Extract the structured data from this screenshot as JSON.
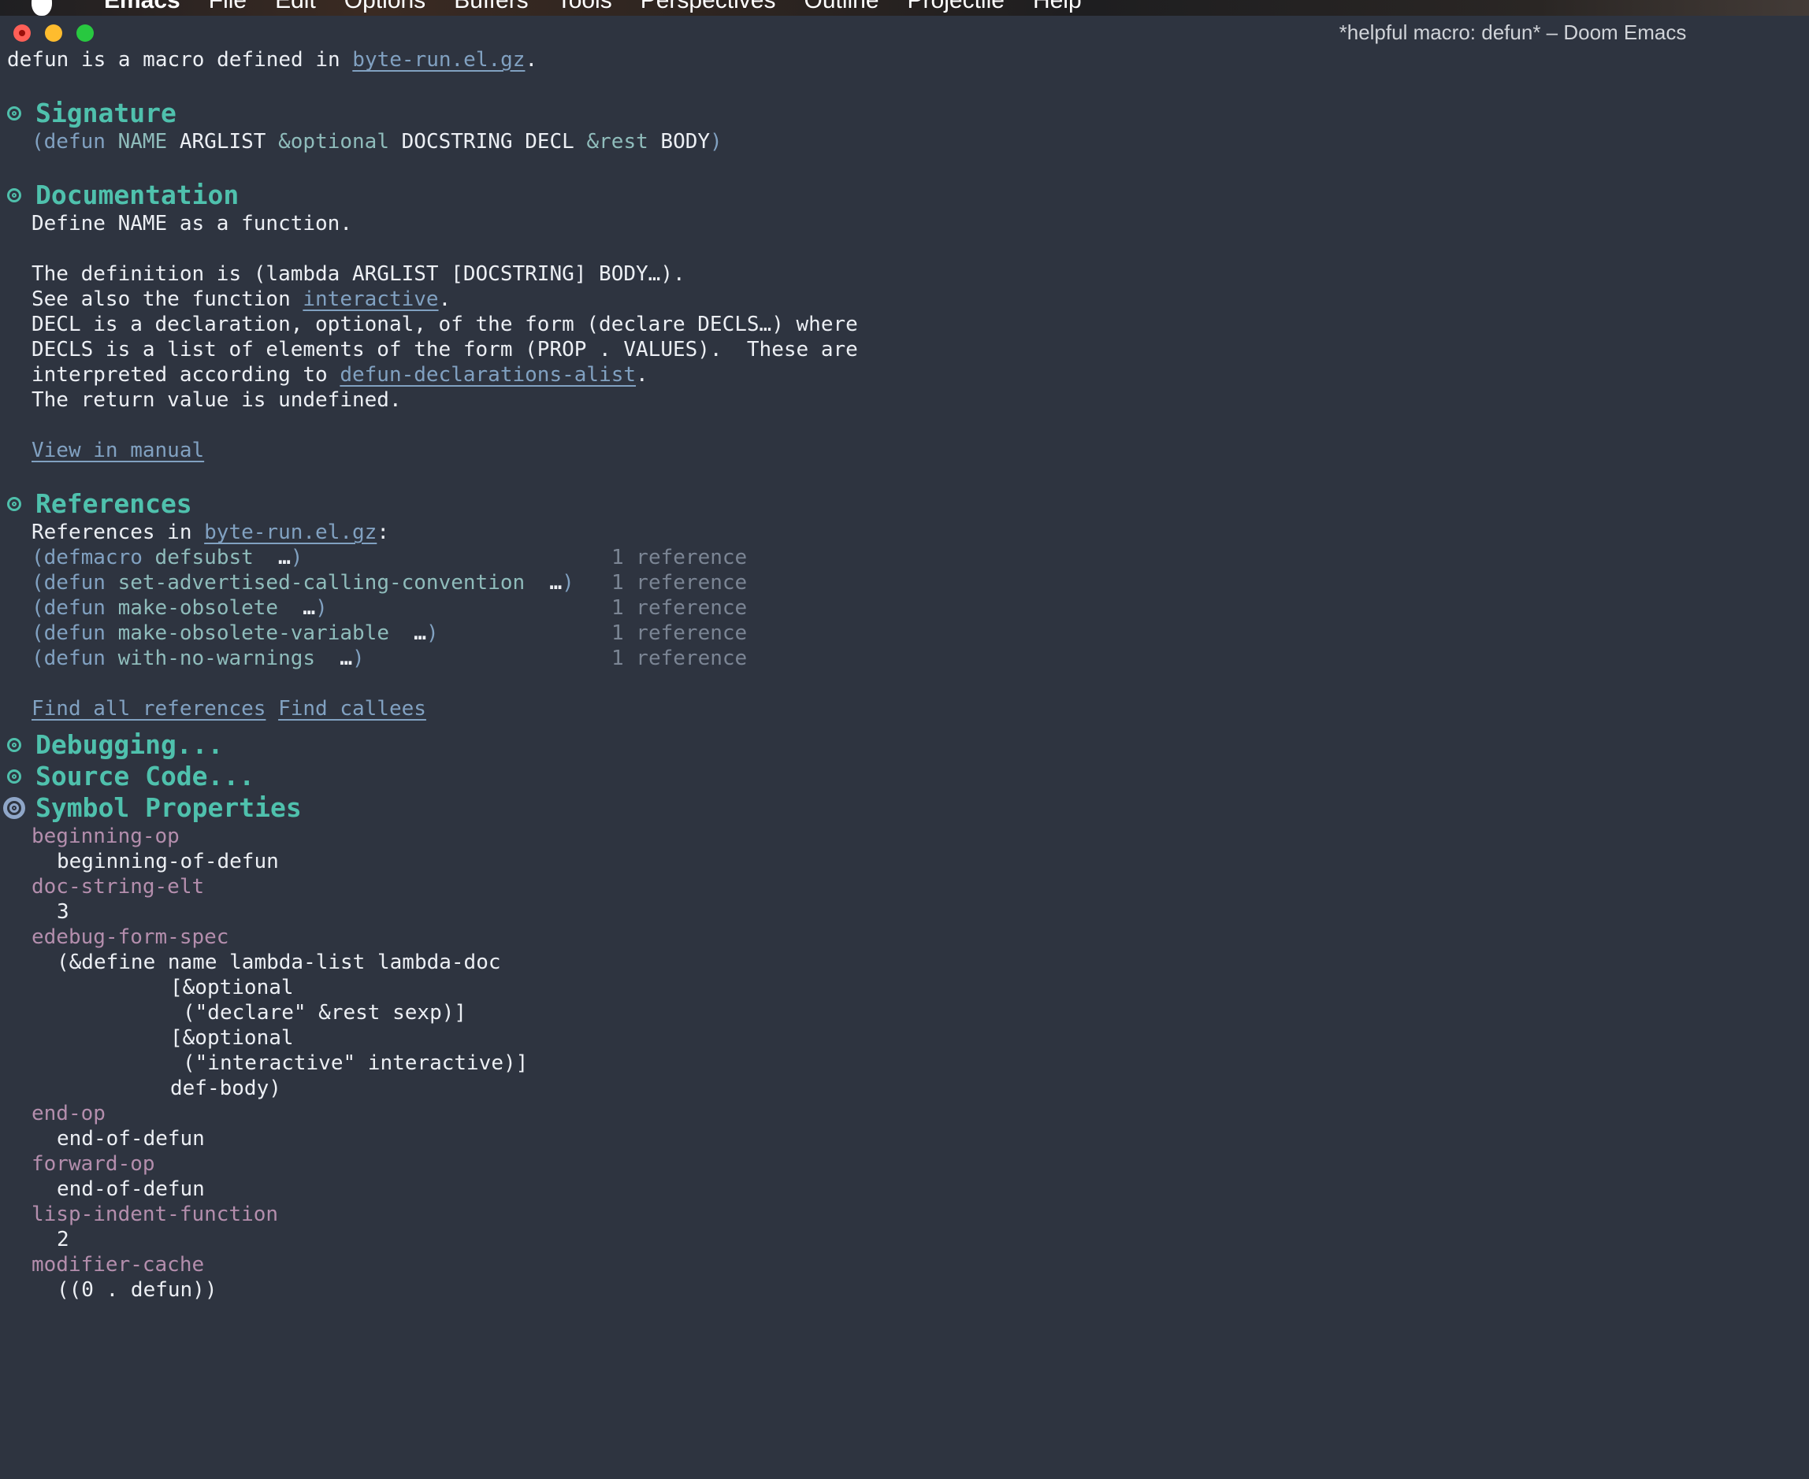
{
  "menubar": {
    "app": "Emacs",
    "items": [
      "File",
      "Edit",
      "Options",
      "Buffers",
      "Tools",
      "Perspectives",
      "Outline",
      "Projectile",
      "Help"
    ]
  },
  "window": {
    "title": "*helpful macro: defun* – Doom Emacs"
  },
  "intro": {
    "prefix": "defun is a macro defined in ",
    "file_link": "byte-run.el.gz",
    "suffix": "."
  },
  "signature": {
    "heading": "Signature",
    "open": "(",
    "defun": "defun",
    "name": "NAME",
    "arglist": "ARGLIST",
    "optional": "&optional",
    "docstring": "DOCSTRING",
    "decl": "DECL",
    "rest": "&rest",
    "body": "BODY",
    "close": ")"
  },
  "documentation": {
    "heading": "Documentation",
    "line1": "Define NAME as a function.",
    "line2": "The definition is (lambda ARGLIST [DOCSTRING] BODY…).",
    "line3_prefix": "See also the function ",
    "line3_link": "interactive",
    "line3_suffix": ".",
    "line4": "DECL is a declaration, optional, of the form (declare DECLS…) where",
    "line5": "DECLS is a list of elements of the form (PROP . VALUES).  These are",
    "line6_prefix": "interpreted according to ",
    "line6_link": "defun-declarations-alist",
    "line6_suffix": ".",
    "line7": "The return value is undefined.",
    "manual_link": "View in manual"
  },
  "references": {
    "heading": "References",
    "intro_prefix": "References in ",
    "intro_link": "byte-run.el.gz",
    "intro_suffix": ":",
    "items": [
      {
        "kind": "defmacro",
        "name": "defsubst",
        "count": "1 reference"
      },
      {
        "kind": "defun",
        "name": "set-advertised-calling-convention",
        "count": "1 reference"
      },
      {
        "kind": "defun",
        "name": "make-obsolete",
        "count": "1 reference"
      },
      {
        "kind": "defun",
        "name": "make-obsolete-variable",
        "count": "1 reference"
      },
      {
        "kind": "defun",
        "name": "with-no-warnings",
        "count": "1 reference"
      }
    ],
    "ellipsis": "…",
    "find_all": "Find all references",
    "find_callees": "Find callees"
  },
  "collapsed_sections": {
    "debugging": "Debugging...",
    "source_code": "Source Code..."
  },
  "symbol_properties": {
    "heading": "Symbol Properties",
    "props": [
      {
        "name": "beginning-op",
        "value": "beginning-of-defun"
      },
      {
        "name": "doc-string-elt",
        "value": "3"
      },
      {
        "name": "edebug-form-spec",
        "value_lines": [
          "(&define name lambda-list lambda-doc",
          "[&optional",
          "(\"declare\" &rest sexp)]",
          "[&optional",
          "(\"interactive\" interactive)]",
          "def-body)"
        ]
      },
      {
        "name": "end-op",
        "value": "end-of-defun"
      },
      {
        "name": "forward-op",
        "value": "end-of-defun"
      },
      {
        "name": "lisp-indent-function",
        "value": "2"
      },
      {
        "name": "modifier-cache",
        "value": "((0 . defun))"
      }
    ]
  }
}
